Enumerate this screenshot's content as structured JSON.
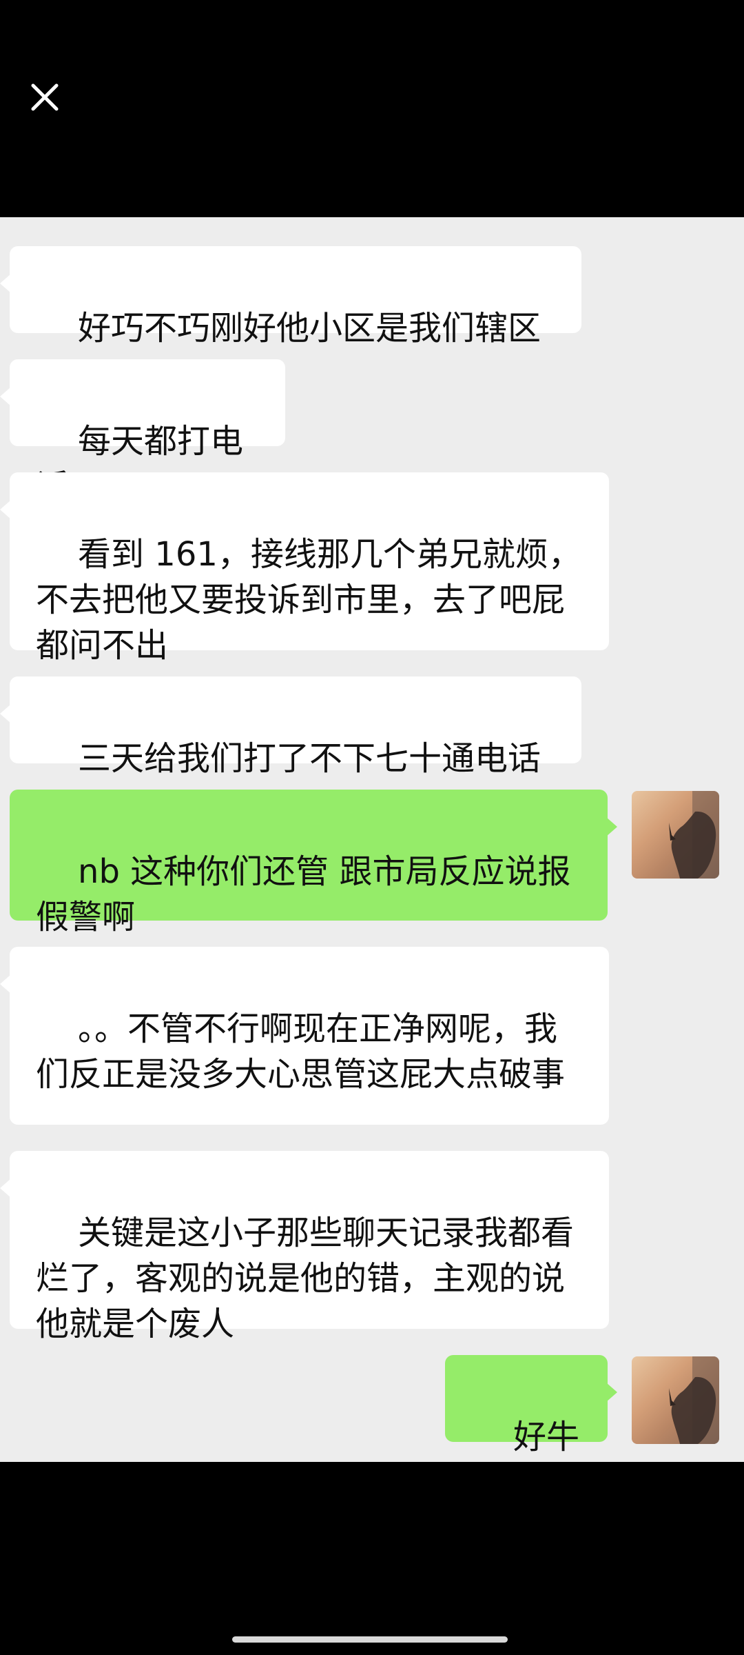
{
  "viewer": {
    "close_icon": "close-icon"
  },
  "messages": [
    {
      "side": "left",
      "text": "好巧不巧刚好他小区是我们辖区"
    },
    {
      "side": "left",
      "text": "每天都打电话"
    },
    {
      "side": "left",
      "text": "看到 161，接线那几个弟兄就烦，不去把他又要投诉到市里，去了吧屁都问不出"
    },
    {
      "side": "left",
      "text": "三天给我们打了不下七十通电话"
    },
    {
      "side": "right",
      "text": "nb 这种你们还管 跟市局反应说报假警啊"
    },
    {
      "side": "left",
      "text": "。。不管不行啊现在正净网呢，我们反正是没多大心思管这屁大点破事"
    },
    {
      "side": "left",
      "text": "关键是这小子那些聊天记录我都看烂了，客观的说是他的错，主观的说他就是个废人"
    },
    {
      "side": "right",
      "text": "好牛逼"
    }
  ],
  "colors": {
    "chat_background": "#ededed",
    "incoming_bubble": "#ffffff",
    "outgoing_bubble": "#95ec69",
    "frame": "#000000"
  }
}
